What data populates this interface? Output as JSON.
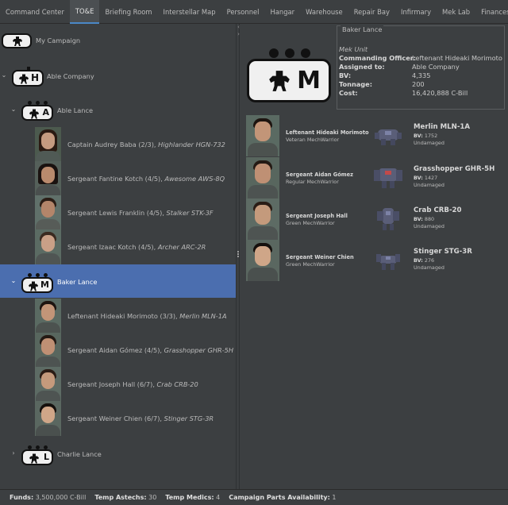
{
  "tabs": [
    "Command Center",
    "TO&E",
    "Briefing Room",
    "Interstellar Map",
    "Personnel",
    "Hangar",
    "Warehouse",
    "Repair Bay",
    "Infirmary",
    "Mek Lab",
    "Finances"
  ],
  "active_tab": "TO&E",
  "tree": {
    "campaign": "My Campaign",
    "company": "Able Company",
    "company_letter": "H",
    "lance_a": "Able Lance",
    "lance_a_letter": "A",
    "lance_a_members": [
      {
        "name": "Captain Audrey Baba (2/3), ",
        "unit": "Highlander HGN-732"
      },
      {
        "name": "Sergeant Fantine Kotch (4/5), ",
        "unit": "Awesome AWS-8Q"
      },
      {
        "name": "Sergeant Lewis Franklin (4/5), ",
        "unit": "Stalker STK-3F"
      },
      {
        "name": "Sergeant Izaac Kotch (4/5), ",
        "unit": "Archer ARC-2R"
      }
    ],
    "lance_b": "Baker Lance",
    "lance_b_letter": "M",
    "lance_b_members": [
      {
        "name": "Leftenant Hideaki Morimoto (3/3), ",
        "unit": "Merlin MLN-1A"
      },
      {
        "name": "Sergeant Aidan Gómez (4/5), ",
        "unit": "Grasshopper GHR-5H"
      },
      {
        "name": "Sergeant Joseph Hall (6/7), ",
        "unit": "Crab CRB-20"
      },
      {
        "name": "Sergeant Weiner Chien (6/7), ",
        "unit": "Stinger STG-3R"
      }
    ],
    "lance_c": "Charlie Lance",
    "lance_c_letter": "L"
  },
  "detail": {
    "title": "Baker Lance",
    "unit_type": "Mek Unit",
    "big_letter": "M",
    "fields": [
      {
        "key": "Commanding Officer:",
        "value": "Leftenant Hideaki Morimoto"
      },
      {
        "key": "Assigned to:",
        "value": "Able Company"
      },
      {
        "key": "BV:",
        "value": "4,335"
      },
      {
        "key": "Tonnage:",
        "value": "200"
      },
      {
        "key": "Cost:",
        "value": "16,420,888 C-Bill"
      }
    ],
    "forces": [
      {
        "pilot": "Leftenant Hideaki Morimoto",
        "skill": "Veteran MechWarrior",
        "mech": "Merlin MLN-1A",
        "bv_label": "BV:",
        "bv": "1752",
        "status": "Undamaged"
      },
      {
        "pilot": "Sergeant Aidan Gómez",
        "skill": "Regular MechWarrior",
        "mech": "Grasshopper GHR-5H",
        "bv_label": "BV:",
        "bv": "1427",
        "status": "Undamaged"
      },
      {
        "pilot": "Sergeant Joseph Hall",
        "skill": "Green MechWarrior",
        "mech": "Crab CRB-20",
        "bv_label": "BV:",
        "bv": "880",
        "status": "Undamaged"
      },
      {
        "pilot": "Sergeant Weiner Chien",
        "skill": "Green MechWarrior",
        "mech": "Stinger STG-3R",
        "bv_label": "BV:",
        "bv": "276",
        "status": "Undamaged"
      }
    ]
  },
  "status": {
    "funds_label": "Funds:",
    "funds": "3,500,000 C-Bill",
    "astechs_label": "Temp Astechs:",
    "astechs": "30",
    "medics_label": "Temp Medics:",
    "medics": "4",
    "parts_label": "Campaign Parts Availability:",
    "parts": "1"
  },
  "colors": {
    "selection": "#4b6eaf",
    "background": "#3c3f41",
    "tab_accent": "#4a88c7"
  },
  "icons": [
    "mech-silhouette-icon",
    "chevron-down-icon",
    "chevron-right-icon",
    "collapse-left-icon",
    "collapse-right-icon"
  ]
}
